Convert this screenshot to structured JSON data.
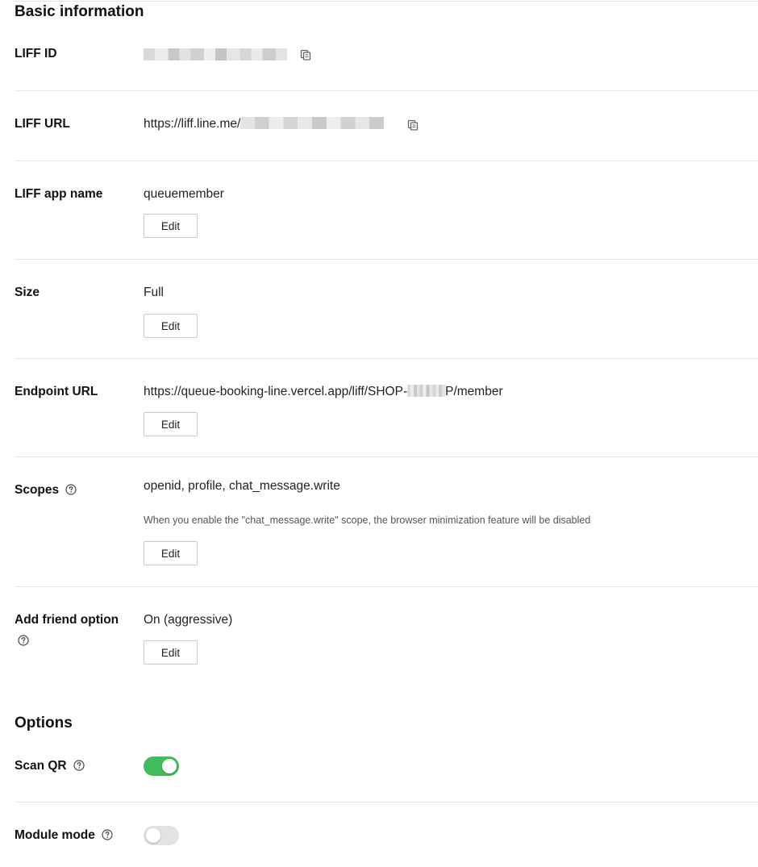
{
  "basic": {
    "title": "Basic information",
    "liff_id": {
      "label": "LIFF ID"
    },
    "liff_url": {
      "label": "LIFF URL",
      "value_prefix": "https://liff.line.me/"
    },
    "app_name": {
      "label": "LIFF app name",
      "value": "queuemember",
      "edit": "Edit"
    },
    "size": {
      "label": "Size",
      "value": "Full",
      "edit": "Edit"
    },
    "endpoint": {
      "label": "Endpoint URL",
      "value_prefix": "https://queue-booking-line.vercel.app/liff/SHOP-",
      "value_suffix": "P/member",
      "edit": "Edit"
    },
    "scopes": {
      "label": "Scopes",
      "value": "openid, profile, chat_message.write",
      "note": "When you enable the \"chat_message.write\" scope, the browser minimization feature will be disabled",
      "edit": "Edit"
    },
    "add_friend": {
      "label": "Add friend option",
      "value": "On (aggressive)",
      "edit": "Edit"
    }
  },
  "options": {
    "title": "Options",
    "scan_qr": {
      "label": "Scan QR",
      "enabled": true
    },
    "module_mode": {
      "label": "Module mode",
      "enabled": false
    }
  },
  "colors": {
    "toggle_on": "#3fbd5a",
    "toggle_off": "#e3e3e6",
    "divider": "#e6e6e6"
  },
  "icons": {
    "copy": "copy-icon",
    "help": "question-circle-icon"
  }
}
